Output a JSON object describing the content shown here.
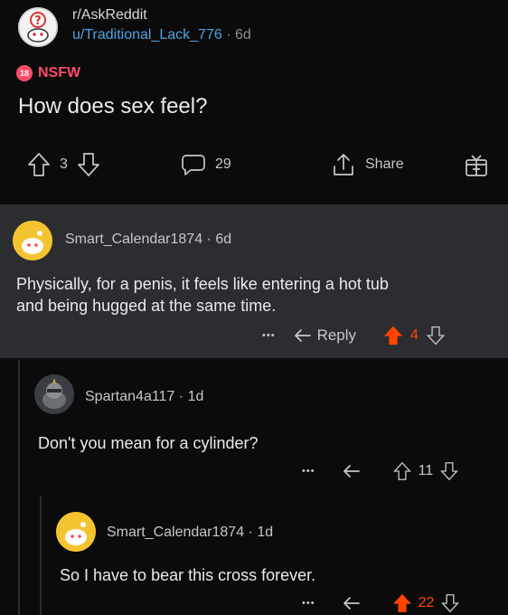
{
  "post": {
    "subreddit": "r/AskReddit",
    "user": "u/Traditional_Lack_776",
    "age": "6d",
    "nsfw_badge": "18",
    "nsfw_label": "NSFW",
    "title": "How does sex feel?",
    "upvotes": "3",
    "comments": "29",
    "share_label": "Share"
  },
  "comments": [
    {
      "user": "Smart_Calendar1874",
      "age": "6d",
      "text_line1": "Physically, for a penis, it feels like entering a hot tub",
      "text_line2": "and being hugged at the same time.",
      "reply_label": "Reply",
      "more": "•••",
      "score": "4",
      "highlighted": true
    },
    {
      "user": "Spartan4a117",
      "age": "1d",
      "text": "Don't you mean for a cylinder?",
      "more": "•••",
      "score": "11"
    },
    {
      "user": "Smart_Calendar1874",
      "age": "1d",
      "text": "So I have to bear this cross forever.",
      "more": "•••",
      "score": "22"
    }
  ],
  "colors": {
    "background": "#0b0b0c",
    "highlight": "#2c2d31",
    "upvote_active": "#ff4500",
    "link_blue": "#4fa3e0",
    "nsfw": "#ff4b6a"
  },
  "icons": [
    "askreddit-icon",
    "upvote-icon",
    "downvote-icon",
    "comment-icon",
    "share-icon",
    "award-icon",
    "reply-icon",
    "more-icon"
  ]
}
